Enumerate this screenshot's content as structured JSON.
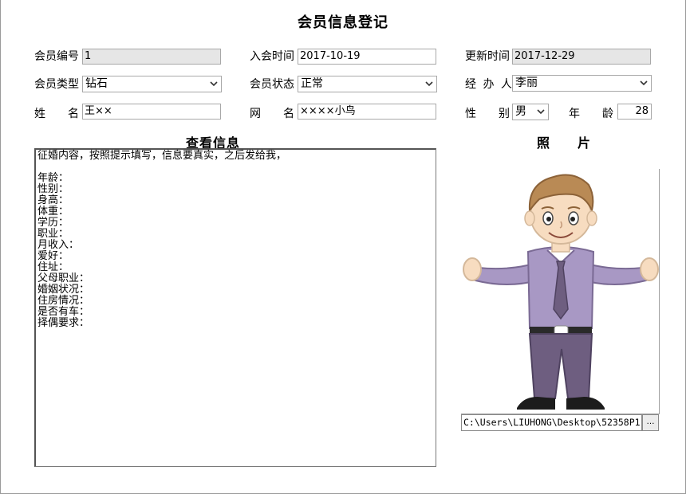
{
  "title": "会员信息登记",
  "fields": {
    "member_no_label": "会员编号",
    "member_no_value": "1",
    "join_time_label": "入会时间",
    "join_time_value": "2017-10-19",
    "update_time_label": "更新时间",
    "update_time_value": "2017-12-29",
    "member_type_label": "会员类型",
    "member_type_value": "钻石",
    "member_status_label": "会员状态",
    "member_status_value": "正常",
    "handler_label": "经 办 人",
    "handler_value": "李丽",
    "name_label_1": "姓",
    "name_label_2": "名",
    "name_value": "王××",
    "nickname_label_1": "网",
    "nickname_label_2": "名",
    "nickname_value": "××××小鸟",
    "gender_label_1": "性",
    "gender_label_2": "别",
    "gender_value": "男",
    "age_label_1": "年",
    "age_label_2": "龄",
    "age_value": "28"
  },
  "info": {
    "heading": "查看信息",
    "lines": [
      "征婚内容，按照提示填写，信息要真实，之后发给我，",
      "",
      "年龄：",
      "性别：",
      "身高：",
      "体重：",
      "学历：",
      "职业：",
      "月收入：",
      "爱好：",
      "住址：",
      "父母职业：",
      "婚姻状况：",
      "住房情况：",
      "是否有车：",
      "择偶要求："
    ]
  },
  "photo": {
    "heading": "照　　片",
    "path": "C:\\Users\\LIUHONG\\Desktop\\52358P1",
    "browse_label": "…"
  },
  "colors": {
    "readonly_bg": "#e6e6e6",
    "border": "#a8a8a8",
    "shirt": "#a898c4",
    "pants": "#6e5e80",
    "hair": "#b98a55",
    "skin": "#f7dcc0"
  }
}
